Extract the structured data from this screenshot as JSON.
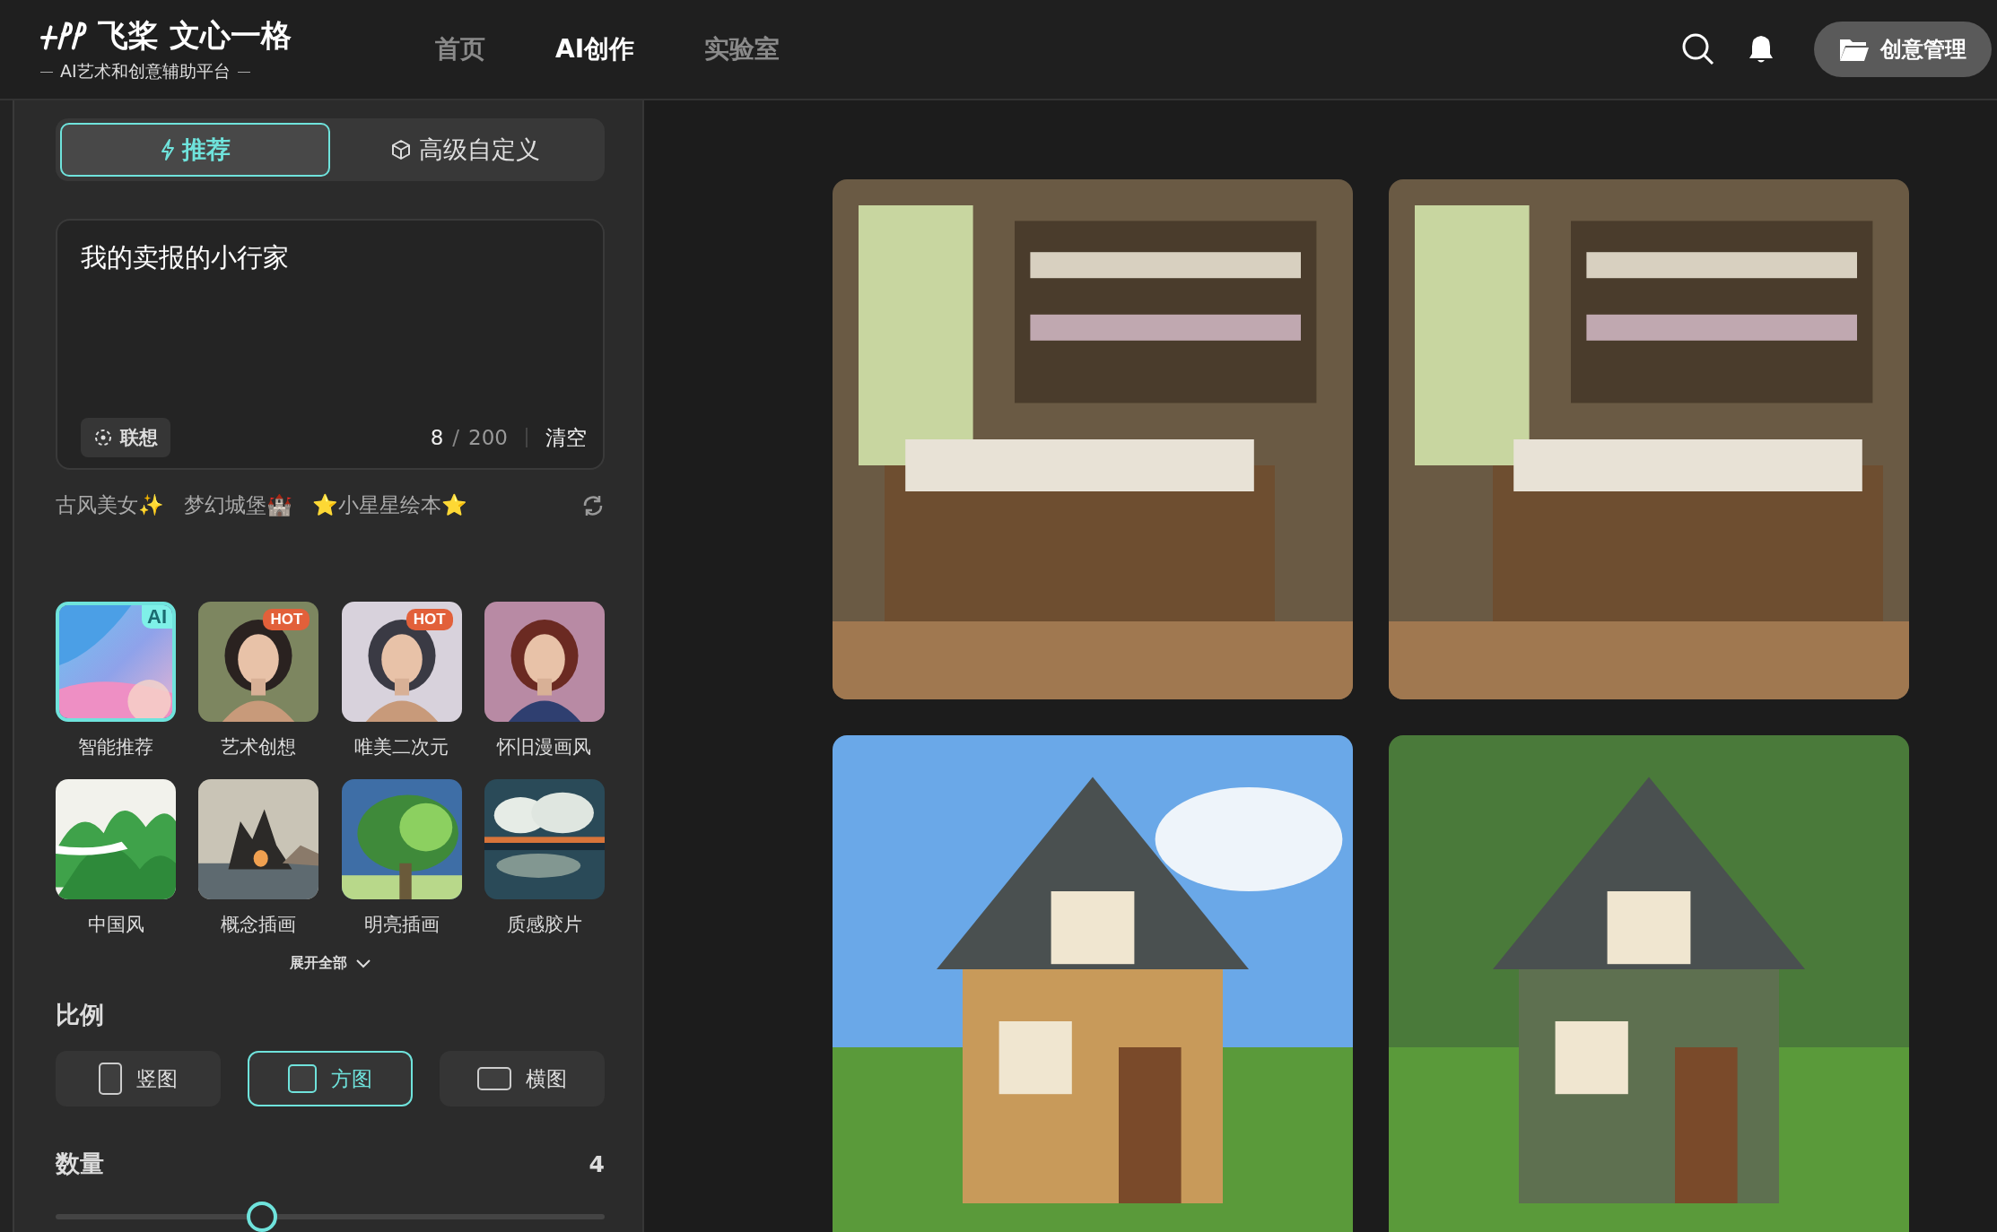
{
  "header": {
    "logo": {
      "name": "飞桨 文心一格",
      "tagline": "AI艺术和创意辅助平台"
    },
    "nav": [
      {
        "label": "首页",
        "selected": false
      },
      {
        "label": "AI创作",
        "selected": true
      },
      {
        "label": "实验室",
        "selected": false
      }
    ],
    "manage_button": "创意管理"
  },
  "mode_tabs": [
    {
      "label": "推荐",
      "selected": true
    },
    {
      "label": "高级自定义",
      "selected": false
    }
  ],
  "prompt": {
    "value": "我的卖报的小行家",
    "associate_button": "联想",
    "counter": {
      "current": "8",
      "separator": "/",
      "limit": "200"
    },
    "clear_button": "清空"
  },
  "suggestions": [
    "古风美女✨",
    "梦幻城堡🏰",
    "⭐小星星绘本⭐"
  ],
  "styles": [
    {
      "label": "智能推荐",
      "badge": "AI",
      "selected": true,
      "kind": "picture"
    },
    {
      "label": "艺术创想",
      "badge": "HOT",
      "selected": false,
      "kind": "picture"
    },
    {
      "label": "唯美二次元",
      "badge": "HOT",
      "selected": false,
      "kind": "picture"
    },
    {
      "label": "怀旧漫画风",
      "selected": false,
      "kind": "picture"
    },
    {
      "label": "中国风",
      "selected": false,
      "kind": "picture"
    },
    {
      "label": "概念插画",
      "selected": false,
      "kind": "picture"
    },
    {
      "label": "明亮插画",
      "selected": false,
      "kind": "picture"
    },
    {
      "label": "质感胶片",
      "selected": false,
      "kind": "picture"
    }
  ],
  "expand_button": "展开全部",
  "ratio": {
    "title": "比例",
    "options": [
      {
        "label": "竖图",
        "kind": "portrait",
        "selected": false
      },
      {
        "label": "方图",
        "kind": "square",
        "selected": true
      },
      {
        "label": "横图",
        "kind": "landscape",
        "selected": false
      }
    ]
  },
  "quantity": {
    "title": "数量",
    "value": "4",
    "level": 0.375
  },
  "gallery": [
    {
      "kind": "picture"
    },
    {
      "kind": "picture"
    },
    {
      "kind": "picture"
    },
    {
      "kind": "picture"
    }
  ]
}
